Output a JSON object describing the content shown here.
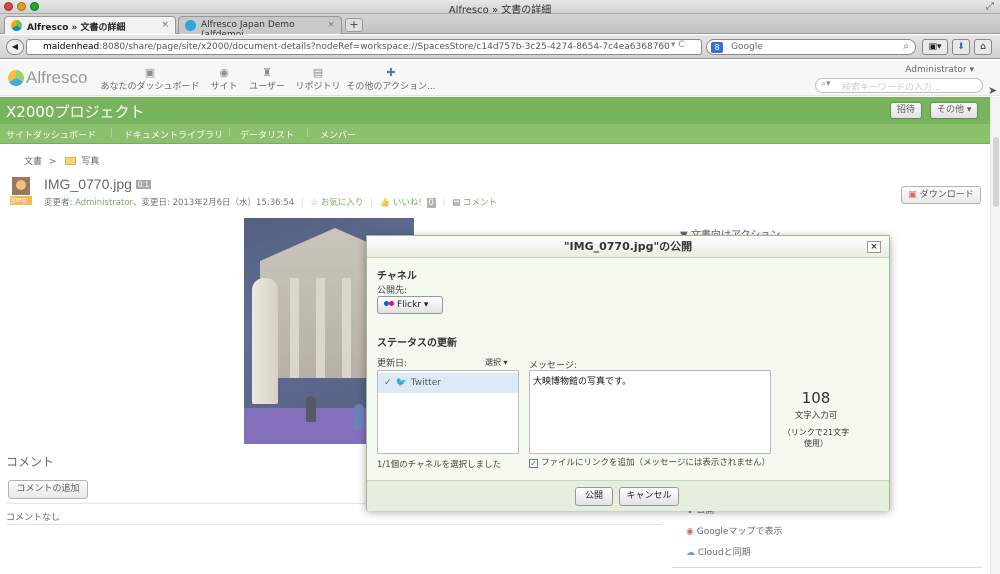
{
  "window": {
    "title": "Alfresco » 文書の詳細"
  },
  "tabs": [
    {
      "label": "Alfresco » 文書の詳細",
      "close": "×"
    },
    {
      "label": "Alfresco Japan Demo (alfdemoj...",
      "close": "×"
    }
  ],
  "newtab": "+",
  "urlbar": {
    "host": "maidenhead",
    "rest": ":8080/share/page/site/x2000/document-details?nodeRef=workspace://SpacesStore/c14d757b-3c25-4274-8654-7c4ea6368760",
    "icons": "☆ ▾ C"
  },
  "searchbar": {
    "engine": "8",
    "placeholder": "Google"
  },
  "header": {
    "logo": "Alfresco",
    "nav": [
      {
        "label": "あなたのダッシュボード",
        "icon": "▣"
      },
      {
        "label": "サイト",
        "icon": "◉"
      },
      {
        "label": "ユーザー",
        "icon": "♜"
      },
      {
        "label": "リポジトリ",
        "icon": "▤"
      },
      {
        "label": "その他のアクション...",
        "icon": "✚"
      }
    ],
    "user": "Administrator ▾",
    "search_placeholder": "検索キーワードの入力..."
  },
  "site": {
    "title": "X2000プロジェクト",
    "invite": "招待",
    "more": "その他 ▾",
    "nav": [
      "サイトダッシュボード",
      "ドキュメントライブラリ",
      "データリスト",
      "メンバー"
    ]
  },
  "breadcrumb": {
    "root": "文書",
    "sep": ">",
    "folder": "写真"
  },
  "document": {
    "name": "IMG_0770.jpg",
    "version": "0.1",
    "meta_prefix": "変更者: ",
    "modifier": "Administrator",
    "meta_mid": "、変更日: 2013年2月6日（水）15:36:54",
    "favorite": "☆ お気に入り",
    "like": "いいね!",
    "like_count": "0",
    "comment": "コメント",
    "download": "ダウンロード",
    "icon_label": "Jpeg"
  },
  "sidebar": {
    "actions_header": "▼ 文書向けアクション",
    "links": [
      "公開",
      "Googleマップで表示",
      "Cloudと同期"
    ]
  },
  "comments": {
    "header": "コメント",
    "add_button": "コメントの追加",
    "empty": "コメントなし"
  },
  "dialog": {
    "title": "\"IMG_0770.jpg\"の公開",
    "close": "×",
    "channel_header": "チャネル",
    "publish_to": "公開先:",
    "channel_button": "Flickr ▾",
    "status_header": "ステータスの更新",
    "update_label": "更新日:",
    "select_label": "選択 ▾",
    "message_label": "メッセージ:",
    "channels": [
      {
        "name": "Twitter"
      }
    ],
    "message_value": "大映博物館の写真です。",
    "counter_value": "108",
    "counter_label": "文字入力可",
    "counter_note": "（リンクで21文字使用）",
    "selected_count": "1/1個のチャネルを選択しました",
    "add_link_label": "ファイルにリンクを追加（メッセージには表示されません）",
    "publish_button": "公開",
    "cancel_button": "キャンセル"
  },
  "colors": {
    "green_dark": "#4b9a27",
    "green_light": "#64ad3d",
    "link_green": "#4b8f2b"
  }
}
